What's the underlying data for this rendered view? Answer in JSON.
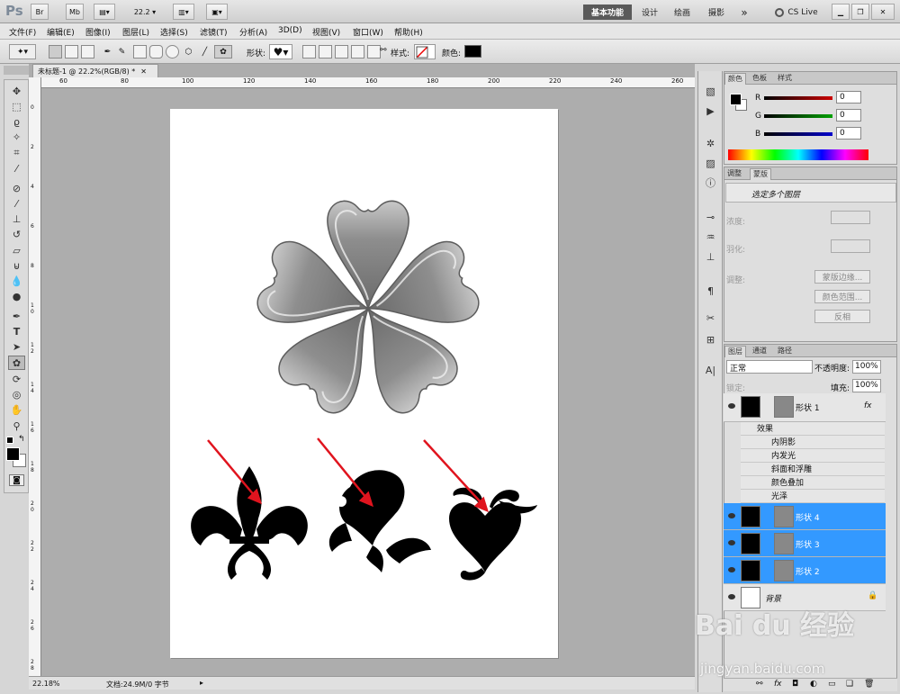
{
  "app": {
    "logo": "Ps",
    "zoom_combo": "22.2",
    "cs_live": "CS Live"
  },
  "titlebar": {
    "btn_br": "Br",
    "btn_mb": "Mb",
    "workspaces": [
      "基本功能",
      "设计",
      "绘画",
      "摄影"
    ],
    "more": "»"
  },
  "menu": [
    "文件(F)",
    "编辑(E)",
    "图像(I)",
    "图层(L)",
    "选择(S)",
    "滤镜(T)",
    "分析(A)",
    "3D(D)",
    "视图(V)",
    "窗口(W)",
    "帮助(H)"
  ],
  "options": {
    "shape_label": "形状:",
    "style_label": "样式:",
    "color_label": "颜色:",
    "color_value": "#000000"
  },
  "document": {
    "tab_title": "未标题-1 @ 22.2%(RGB/8) *",
    "ruler_ticks": [
      "60",
      "80",
      "100",
      "120",
      "140",
      "160",
      "180",
      "200",
      "220",
      "240",
      "260"
    ],
    "vruler_ticks": [
      "0",
      "2",
      "4",
      "6",
      "8",
      "1 0",
      "1 2",
      "1 4",
      "1 6",
      "1 8",
      "2 0",
      "2 2",
      "2 4",
      "2 6",
      "2 8"
    ]
  },
  "status": {
    "zoom": "22.18%",
    "doc_info": "文档:24.9M/0 字节"
  },
  "color_panel": {
    "tabs": [
      "颜色",
      "色板",
      "样式"
    ],
    "channels": [
      {
        "label": "R",
        "value": "0",
        "color": "#cc0000"
      },
      {
        "label": "G",
        "value": "0",
        "color": "#00a000"
      },
      {
        "label": "B",
        "value": "0",
        "color": "#0000cc"
      }
    ]
  },
  "masks_panel": {
    "tabs": [
      "调整",
      "蒙版"
    ],
    "status": "选定多个图层",
    "density": "浓度:",
    "feather": "羽化:",
    "refine": "调整:",
    "btn_edge": "蒙版边缘...",
    "btn_range": "颜色范围...",
    "btn_invert": "反相"
  },
  "layers_panel": {
    "tabs": [
      "图层",
      "通道",
      "路径"
    ],
    "blend_mode": "正常",
    "opacity_label": "不透明度:",
    "opacity": "100%",
    "lock_label": "锁定:",
    "fill_label": "填充:",
    "fill": "100%",
    "layers": [
      {
        "name": "形状 1",
        "selected": false,
        "fx": "fx"
      },
      {
        "name": "形状 4",
        "selected": true
      },
      {
        "name": "形状 3",
        "selected": true
      },
      {
        "name": "形状 2",
        "selected": true
      },
      {
        "name": "背景",
        "selected": false
      }
    ],
    "effects_header": "效果",
    "effects": [
      "内阴影",
      "内发光",
      "斜面和浮雕",
      "颜色叠加",
      "光泽"
    ]
  },
  "watermark": {
    "text": "Bai du 经验",
    "url": "jingyan.baidu.com"
  },
  "colors": {
    "selection": "#3399ff",
    "arrow": "#e0141e"
  }
}
